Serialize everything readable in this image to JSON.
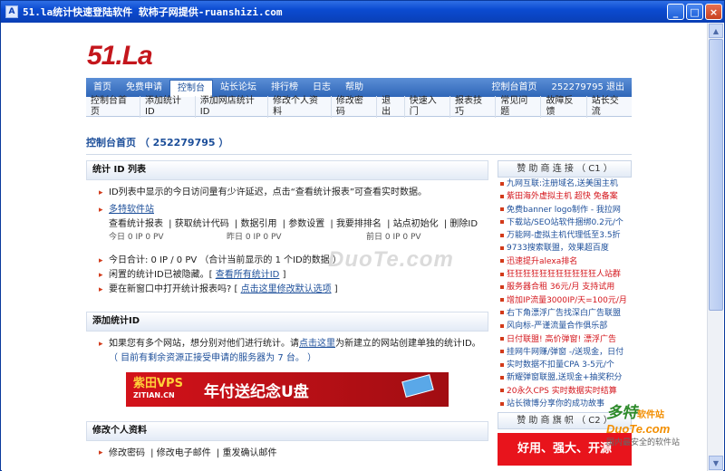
{
  "window": {
    "title": "51.la统计快速登陆软件 软柿子网提供-ruanshizi.com",
    "minimize": "_",
    "maximize": "□",
    "close": "×"
  },
  "logo": {
    "text": "51.La"
  },
  "nav": {
    "items": [
      "首页",
      "免费申请",
      "控制台",
      "站长论坛",
      "排行榜",
      "日志",
      "帮助"
    ],
    "right": [
      "控制台首页",
      "252279795 退出"
    ]
  },
  "subnav": [
    "控制台首页",
    "添加统计ID",
    "添加网店统计ID",
    "修改个人资料",
    "修改密码",
    "退出",
    "快速入门",
    "报表技巧",
    "常见问题",
    "故障反馈",
    "站长交流"
  ],
  "page_title": "控制台首页 （ 252279795 ）",
  "stat_section": {
    "heading": "统计 ID 列表",
    "intro": "ID列表中显示的今日访问量有少许延迟，点击“查看统计报表”可查看实时数据。",
    "site_name": "多特软件站",
    "links": [
      "查看统计报表",
      "获取统计代码",
      "数据引用",
      "参数设置",
      "我要排排名",
      "站点初始化",
      "删除ID"
    ],
    "today": "今日 0 IP 0 PV",
    "yesterday": "昨日 0 IP 0 PV",
    "dayafter": "前日 0 IP 0 PV",
    "total": "今日合计: 0 IP / 0 PV （合计当前显示的 1 个ID的数据 ）",
    "hidden_prefix": "闲置的统计ID已被隐藏。[ ",
    "hidden_link": "查看所有统计ID",
    "hidden_suffix": " ]",
    "newwin_prefix": "要在新窗口中打开统计报表吗? [ ",
    "newwin_link": "点击这里修改默认选项",
    "newwin_suffix": " ]"
  },
  "add_section": {
    "heading": "添加统计ID",
    "text_prefix": "如果您有多个网站，想分别对他们进行统计。请",
    "text_link": "点击这里",
    "text_suffix": "为新建立的网站创建单独的统计ID。",
    "hint": "（ 目前有剩余资源正接受申请的服务器为 7 台。 ）"
  },
  "banner": {
    "brand": "紫田VPS",
    "brand_url": "ZITIAN.CN",
    "slogan": "年付送纪念U盘"
  },
  "profile_section": {
    "heading": "修改个人资料",
    "links": [
      "修改密码",
      "修改电子邮件",
      "重发确认邮件"
    ]
  },
  "sponsors": {
    "heading": "赞 助 商 连 接 （ C1 ）",
    "items": [
      {
        "text": "九网互联:注册域名,送美国主机",
        "color": "#1d4f9a"
      },
      {
        "text": "紫田海外虚拟主机 超快 免备案",
        "color": "#d4161c"
      },
      {
        "text": "免费banner logo制作 - 我拉网",
        "color": "#1d4f9a"
      },
      {
        "text": "下载站/SEO站软件捆绑0.2元/个",
        "color": "#1d4f9a"
      },
      {
        "text": "万能网-虚拟主机代理低至3.5折",
        "color": "#1d4f9a"
      },
      {
        "text": "9733搜索联盟，效果超百度",
        "color": "#1d4f9a"
      },
      {
        "text": "迅速提升alexa排名",
        "color": "#d4161c"
      },
      {
        "text": "狂狂狂狂狂狂狂狂狂狂狂人站群",
        "color": "#d4161c"
      },
      {
        "text": "服务器合租 36元/月 支持试用",
        "color": "#d4161c"
      },
      {
        "text": "增加IP流量3000IP/天=100元/月",
        "color": "#d4161c"
      },
      {
        "text": "右下角漂浮广告找深白广告联盟",
        "color": "#1d4f9a"
      },
      {
        "text": "风向标-严谨流量合作俱乐部",
        "color": "#1d4f9a"
      },
      {
        "text": "日付联盟! 高价弹窗! 漂浮广告",
        "color": "#d4161c"
      },
      {
        "text": "挂网牛网赚/弹窗 -/送现金，日付",
        "color": "#1d4f9a"
      },
      {
        "text": "实时数据不扣量CPA 3-5元/个",
        "color": "#1d4f9a"
      },
      {
        "text": "新耀弹窗联盟,送现金+抽奖积分",
        "color": "#1d4f9a"
      },
      {
        "text": "20永久CPS 实时数据实时结算",
        "color": "#d4161c"
      },
      {
        "text": "站长微博分享你的成功故事",
        "color": "#1d4f9a"
      }
    ],
    "heading2": "赞 助 商 旗 帜 （ C2 ）",
    "ad": "好用、强大、开源"
  },
  "watermarks": {
    "center": "DuoTe.com",
    "brand": "多特",
    "brand_small": "软件站",
    "url": "DuoTe.com",
    "tagline": "国内最安全的软件站"
  }
}
